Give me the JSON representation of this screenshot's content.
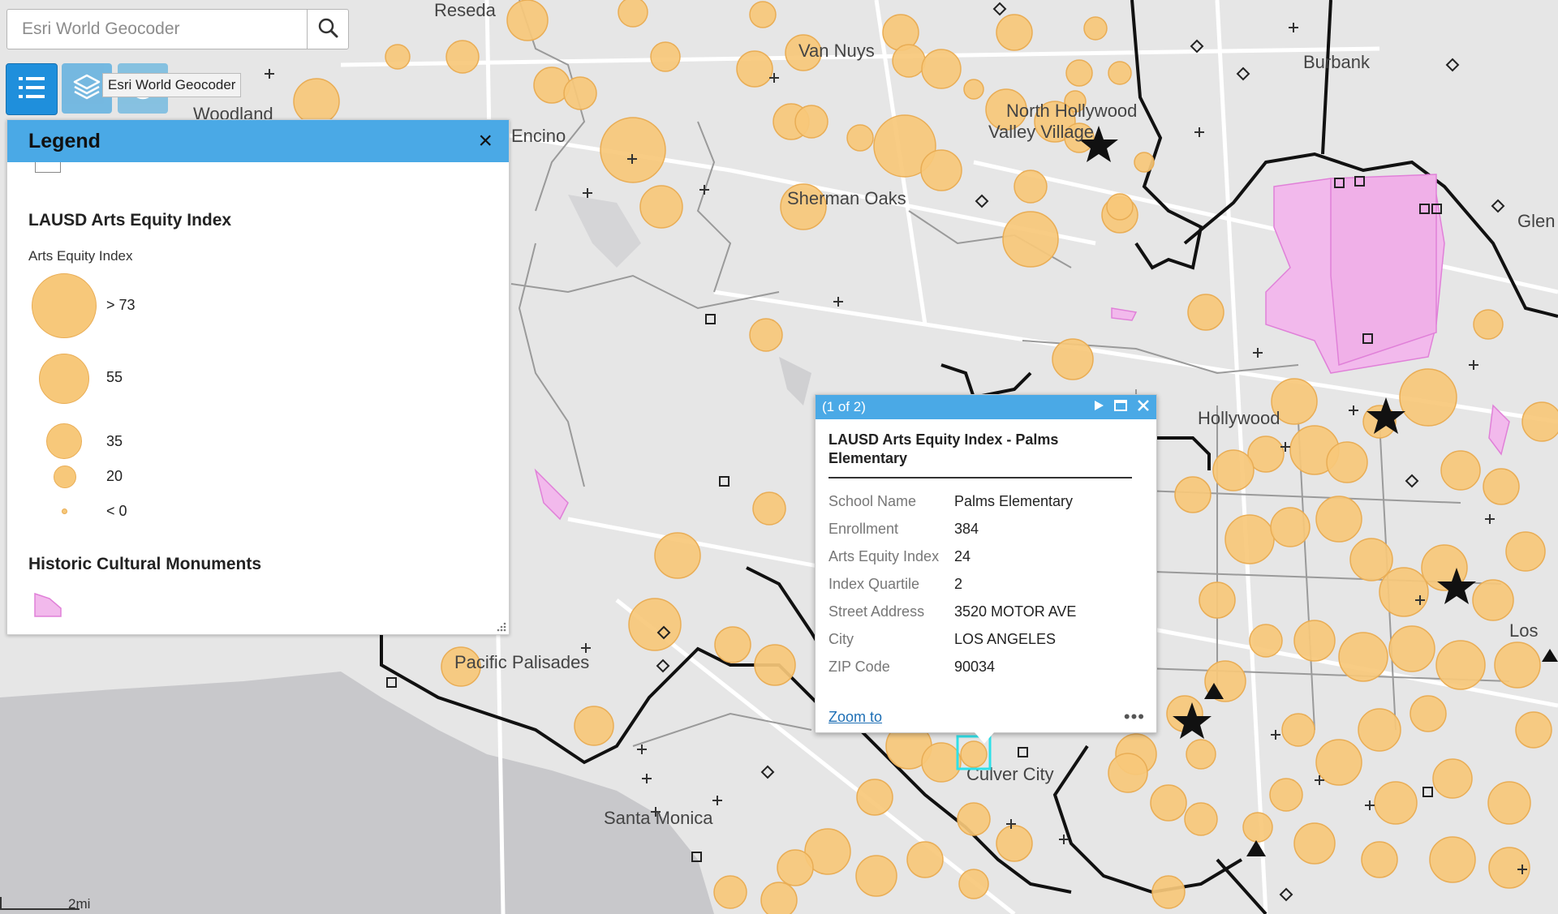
{
  "search": {
    "placeholder": "Esri World Geocoder",
    "tooltip": "Esri World Geocoder"
  },
  "toolbar": {
    "legend_icon": "legend-list-icon",
    "layers_icon": "layers-icon",
    "basemap_icon": "basemap-icon"
  },
  "map_labels": {
    "reseda": "Reseda",
    "van_nuys": "Van Nuys",
    "burbank": "Burbank",
    "woodland": "Woodland",
    "encino": "Encino",
    "north_hollywood": "North Hollywood",
    "valley_village": "Valley Village",
    "sherman_oaks": "Sherman Oaks",
    "glen": "Glen",
    "hollywood": "Hollywood",
    "pacific_palisades": "Pacific Palisades",
    "santa_monica": "Santa Monica",
    "culver_city": "Culver City",
    "los": "Los"
  },
  "legend": {
    "title": "Legend",
    "arts_title": "LAUSD Arts Equity Index",
    "arts_subtitle": "Arts Equity Index",
    "classes": [
      {
        "label": "> 73"
      },
      {
        "label": "55"
      },
      {
        "label": "35"
      },
      {
        "label": "20"
      },
      {
        "label": "< 0"
      }
    ],
    "monuments_title": "Historic Cultural Monuments"
  },
  "popup": {
    "count": "(1 of 2)",
    "title": "LAUSD Arts Equity Index - Palms Elementary",
    "fields": [
      {
        "name": "School Name",
        "value": "Palms Elementary"
      },
      {
        "name": "Enrollment",
        "value": "384"
      },
      {
        "name": "Arts Equity Index",
        "value": "24"
      },
      {
        "name": "Index Quartile",
        "value": "2"
      },
      {
        "name": "Street Address",
        "value": "3520 MOTOR AVE"
      },
      {
        "name": "City",
        "value": "LOS ANGELES"
      },
      {
        "name": "ZIP Code",
        "value": "90034"
      }
    ],
    "zoom": "Zoom to",
    "more": "•••"
  },
  "scale": {
    "label": "2mi"
  },
  "colors": {
    "accent": "#4aa9e6",
    "circle_fill": "#f7c87a",
    "circle_stroke": "#e9ad55",
    "monument_fill": "#f2b9ec",
    "water": "#c8c8cb",
    "land": "#e6e6e6"
  }
}
